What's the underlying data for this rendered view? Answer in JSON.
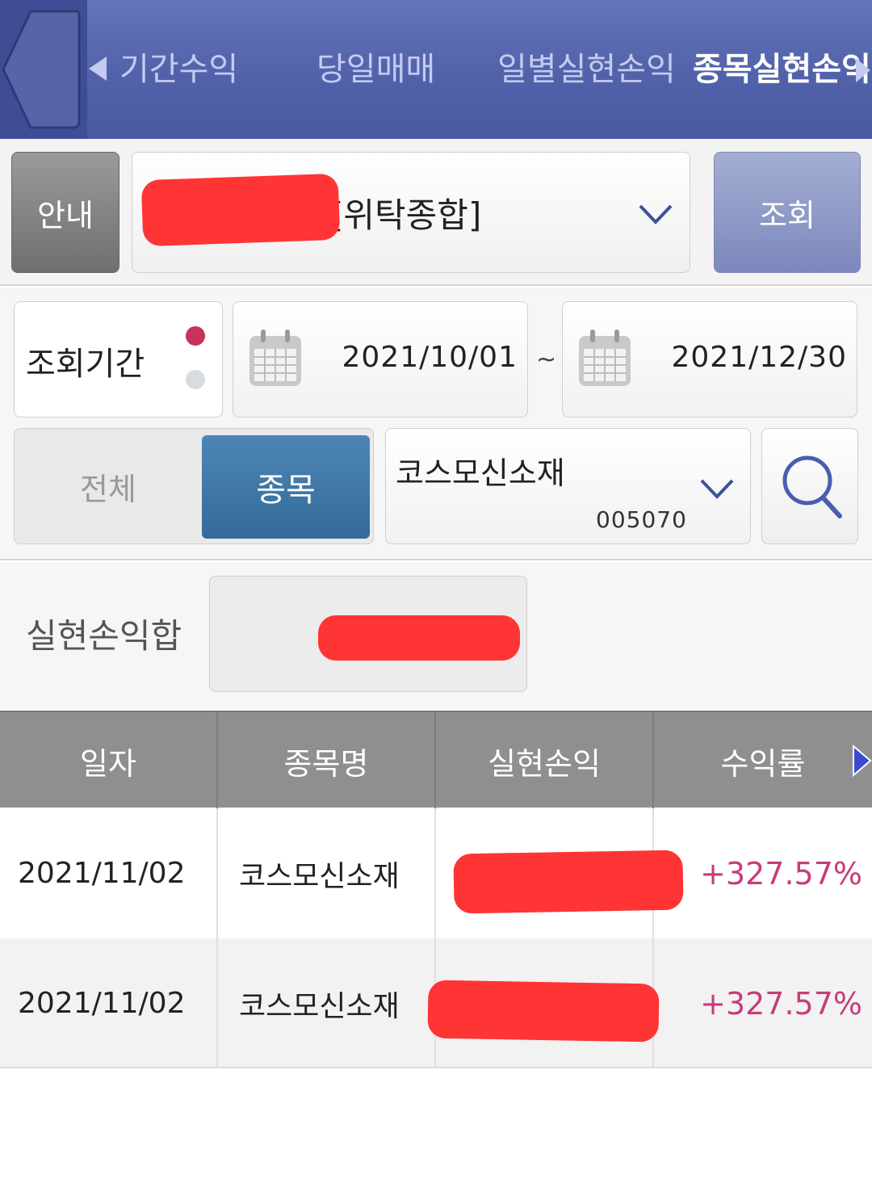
{
  "tabs": [
    {
      "label": "기간수익",
      "active": false
    },
    {
      "label": "당일매매",
      "active": false
    },
    {
      "label": "일별실현손익",
      "active": false
    },
    {
      "label": "종목실현손익",
      "active": true
    }
  ],
  "account_row": {
    "guide_label": "안내",
    "account_type": "[위탁종합]",
    "query_label": "조회"
  },
  "period": {
    "label": "조회기간",
    "start_date": "2021/10/01",
    "separator": "~",
    "end_date": "2021/12/30"
  },
  "filter": {
    "all_label": "전체",
    "item_label": "종목",
    "selected_stock_name": "코스모신소재",
    "selected_stock_code": "005070"
  },
  "summary": {
    "label": "실현손익합"
  },
  "table": {
    "headers": [
      "일자",
      "종목명",
      "실현손익",
      "수익률"
    ],
    "rows": [
      {
        "date": "2021/11/02",
        "name": "코스모신소재",
        "rate": "+327.57%"
      },
      {
        "date": "2021/11/02",
        "name": "코스모신소재",
        "rate": "+327.57%"
      }
    ]
  },
  "colors": {
    "header_bar": "#5262aa",
    "active_segment": "#3d74a4",
    "rate_positive": "#c83b7c",
    "redaction": "#ff3434"
  }
}
